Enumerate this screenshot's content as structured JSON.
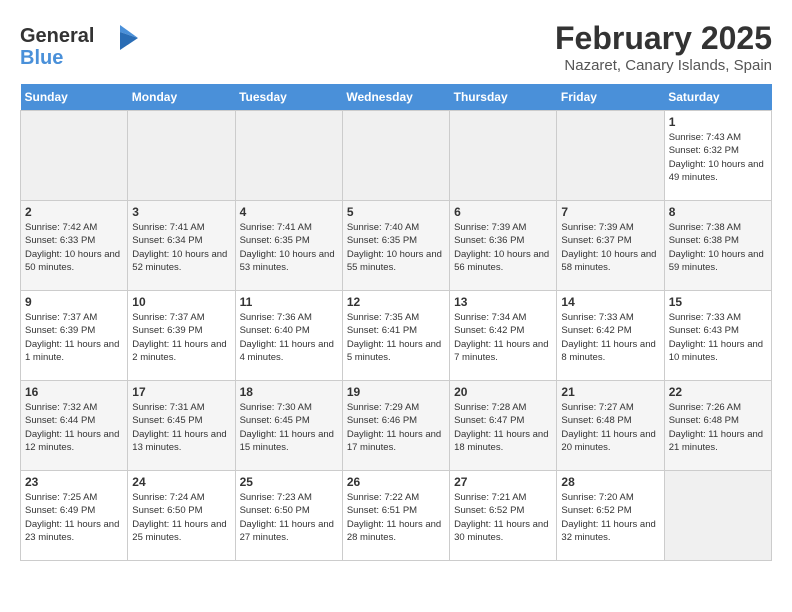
{
  "header": {
    "logo_general": "General",
    "logo_blue": "Blue",
    "month_title": "February 2025",
    "location": "Nazaret, Canary Islands, Spain"
  },
  "weekdays": [
    "Sunday",
    "Monday",
    "Tuesday",
    "Wednesday",
    "Thursday",
    "Friday",
    "Saturday"
  ],
  "weeks": [
    [
      {
        "day": "",
        "info": ""
      },
      {
        "day": "",
        "info": ""
      },
      {
        "day": "",
        "info": ""
      },
      {
        "day": "",
        "info": ""
      },
      {
        "day": "",
        "info": ""
      },
      {
        "day": "",
        "info": ""
      },
      {
        "day": "1",
        "info": "Sunrise: 7:43 AM\nSunset: 6:32 PM\nDaylight: 10 hours\nand 49 minutes."
      }
    ],
    [
      {
        "day": "2",
        "info": "Sunrise: 7:42 AM\nSunset: 6:33 PM\nDaylight: 10 hours\nand 50 minutes."
      },
      {
        "day": "3",
        "info": "Sunrise: 7:41 AM\nSunset: 6:34 PM\nDaylight: 10 hours\nand 52 minutes."
      },
      {
        "day": "4",
        "info": "Sunrise: 7:41 AM\nSunset: 6:35 PM\nDaylight: 10 hours\nand 53 minutes."
      },
      {
        "day": "5",
        "info": "Sunrise: 7:40 AM\nSunset: 6:35 PM\nDaylight: 10 hours\nand 55 minutes."
      },
      {
        "day": "6",
        "info": "Sunrise: 7:39 AM\nSunset: 6:36 PM\nDaylight: 10 hours\nand 56 minutes."
      },
      {
        "day": "7",
        "info": "Sunrise: 7:39 AM\nSunset: 6:37 PM\nDaylight: 10 hours\nand 58 minutes."
      },
      {
        "day": "8",
        "info": "Sunrise: 7:38 AM\nSunset: 6:38 PM\nDaylight: 10 hours\nand 59 minutes."
      }
    ],
    [
      {
        "day": "9",
        "info": "Sunrise: 7:37 AM\nSunset: 6:39 PM\nDaylight: 11 hours\nand 1 minute."
      },
      {
        "day": "10",
        "info": "Sunrise: 7:37 AM\nSunset: 6:39 PM\nDaylight: 11 hours\nand 2 minutes."
      },
      {
        "day": "11",
        "info": "Sunrise: 7:36 AM\nSunset: 6:40 PM\nDaylight: 11 hours\nand 4 minutes."
      },
      {
        "day": "12",
        "info": "Sunrise: 7:35 AM\nSunset: 6:41 PM\nDaylight: 11 hours\nand 5 minutes."
      },
      {
        "day": "13",
        "info": "Sunrise: 7:34 AM\nSunset: 6:42 PM\nDaylight: 11 hours\nand 7 minutes."
      },
      {
        "day": "14",
        "info": "Sunrise: 7:33 AM\nSunset: 6:42 PM\nDaylight: 11 hours\nand 8 minutes."
      },
      {
        "day": "15",
        "info": "Sunrise: 7:33 AM\nSunset: 6:43 PM\nDaylight: 11 hours\nand 10 minutes."
      }
    ],
    [
      {
        "day": "16",
        "info": "Sunrise: 7:32 AM\nSunset: 6:44 PM\nDaylight: 11 hours\nand 12 minutes."
      },
      {
        "day": "17",
        "info": "Sunrise: 7:31 AM\nSunset: 6:45 PM\nDaylight: 11 hours\nand 13 minutes."
      },
      {
        "day": "18",
        "info": "Sunrise: 7:30 AM\nSunset: 6:45 PM\nDaylight: 11 hours\nand 15 minutes."
      },
      {
        "day": "19",
        "info": "Sunrise: 7:29 AM\nSunset: 6:46 PM\nDaylight: 11 hours\nand 17 minutes."
      },
      {
        "day": "20",
        "info": "Sunrise: 7:28 AM\nSunset: 6:47 PM\nDaylight: 11 hours\nand 18 minutes."
      },
      {
        "day": "21",
        "info": "Sunrise: 7:27 AM\nSunset: 6:48 PM\nDaylight: 11 hours\nand 20 minutes."
      },
      {
        "day": "22",
        "info": "Sunrise: 7:26 AM\nSunset: 6:48 PM\nDaylight: 11 hours\nand 21 minutes."
      }
    ],
    [
      {
        "day": "23",
        "info": "Sunrise: 7:25 AM\nSunset: 6:49 PM\nDaylight: 11 hours\nand 23 minutes."
      },
      {
        "day": "24",
        "info": "Sunrise: 7:24 AM\nSunset: 6:50 PM\nDaylight: 11 hours\nand 25 minutes."
      },
      {
        "day": "25",
        "info": "Sunrise: 7:23 AM\nSunset: 6:50 PM\nDaylight: 11 hours\nand 27 minutes."
      },
      {
        "day": "26",
        "info": "Sunrise: 7:22 AM\nSunset: 6:51 PM\nDaylight: 11 hours\nand 28 minutes."
      },
      {
        "day": "27",
        "info": "Sunrise: 7:21 AM\nSunset: 6:52 PM\nDaylight: 11 hours\nand 30 minutes."
      },
      {
        "day": "28",
        "info": "Sunrise: 7:20 AM\nSunset: 6:52 PM\nDaylight: 11 hours\nand 32 minutes."
      },
      {
        "day": "",
        "info": ""
      }
    ]
  ]
}
